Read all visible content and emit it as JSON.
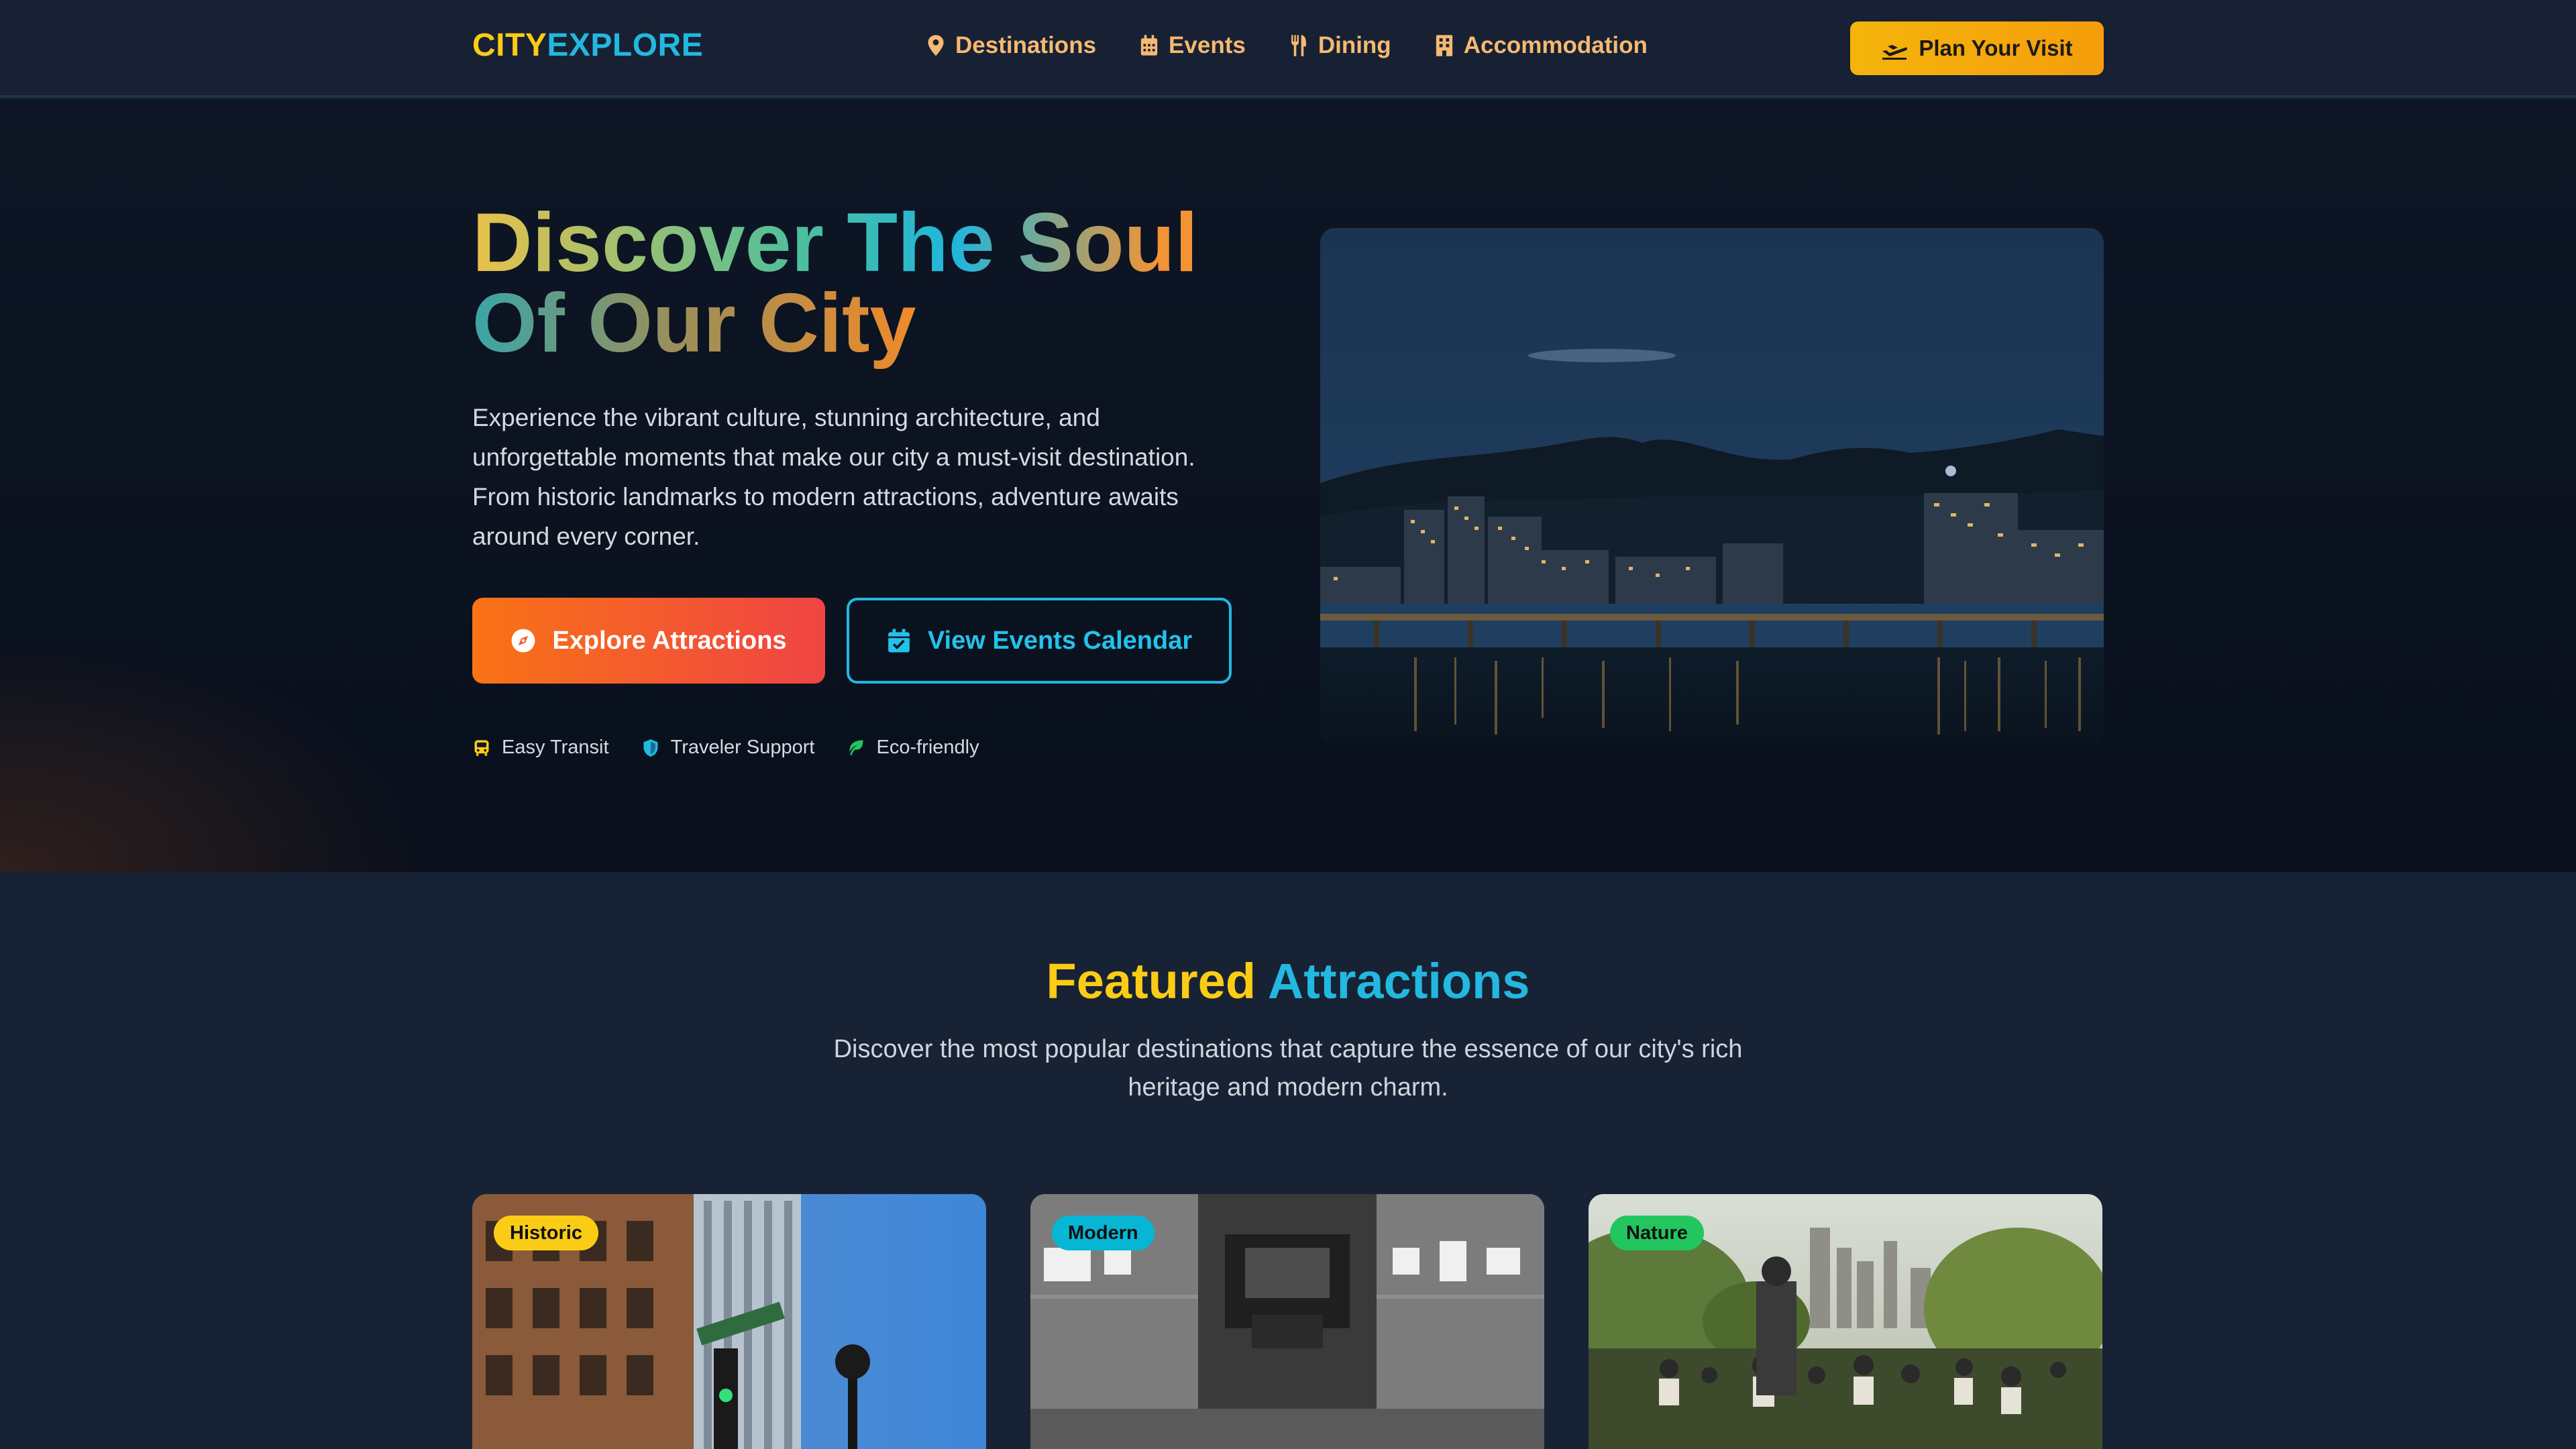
{
  "header": {
    "logo_part1": "CITY",
    "logo_part2": "EXPLORE",
    "nav": [
      {
        "label": "Destinations",
        "icon": "map-pin-icon"
      },
      {
        "label": "Events",
        "icon": "calendar-icon"
      },
      {
        "label": "Dining",
        "icon": "utensils-icon"
      },
      {
        "label": "Accommodation",
        "icon": "building-icon"
      }
    ],
    "cta_label": "Plan Your Visit",
    "cta_icon": "plane-icon"
  },
  "hero": {
    "title_line1_a": "Discover",
    "title_line1_b": "The Soul",
    "title_line2": "Of Our City",
    "description": "Experience the vibrant culture, stunning architecture, and unforgettable moments that make our city a must-visit destination. From historic landmarks to modern attractions, adventure awaits around every corner.",
    "primary_button": "Explore Attractions",
    "primary_icon": "compass-icon",
    "secondary_button": "View Events Calendar",
    "secondary_icon": "calendar-check-icon",
    "features": [
      {
        "label": "Easy Transit",
        "icon": "bus-icon"
      },
      {
        "label": "Traveler Support",
        "icon": "shield-icon"
      },
      {
        "label": "Eco-friendly",
        "icon": "leaf-icon"
      }
    ]
  },
  "featured": {
    "title_a": "Featured",
    "title_b": "Attractions",
    "subtitle": "Discover the most popular destinations that capture the essence of our city's rich heritage and modern charm.",
    "cards": [
      {
        "badge": "Historic"
      },
      {
        "badge": "Modern"
      },
      {
        "badge": "Nature"
      }
    ]
  },
  "colors": {
    "accent_yellow": "#facc15",
    "accent_cyan": "#22b8e0",
    "accent_orange": "#f97316",
    "badge_historic": "#facc15",
    "badge_modern": "#06b6d4",
    "badge_nature": "#22c55e"
  }
}
